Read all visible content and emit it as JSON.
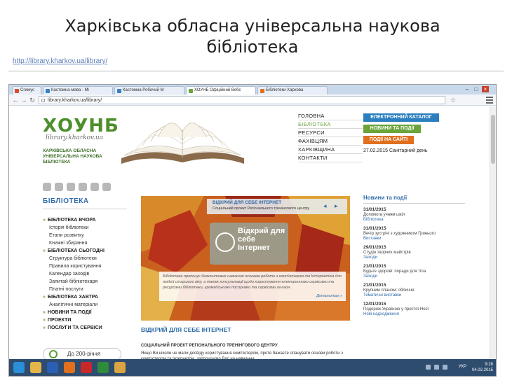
{
  "slide": {
    "title_line1": "Харківська обласна універсальна наукова",
    "title_line2": "бібліотека",
    "link": "http://library.kharkov.ua/library/"
  },
  "browser": {
    "tabs": [
      {
        "label": "Сгимус"
      },
      {
        "label": "Кастомна мова - Мі"
      },
      {
        "label": "Кастомна Робочий М"
      },
      {
        "label": "ХОУНБ Офіційний Вебс"
      },
      {
        "label": "Бібліотеки Харкова"
      }
    ],
    "url": "library.kharkov.ua/library/",
    "colors": {
      "tabbar": "#c9d9ec",
      "close": "#c8412f"
    }
  },
  "site": {
    "logo": {
      "mark": "ХОУНБ",
      "script": "library.kharkov.ua",
      "subtitle": "ХАРКІВСЬКА ОБЛАСНА УНІВЕРСАЛЬНА НАУКОВА БІБЛІОТЕКА"
    },
    "nav": [
      {
        "label": "ГОЛОВНА"
      },
      {
        "label": "БІБЛІОТЕКА"
      },
      {
        "label": "РЕСУРСИ"
      },
      {
        "label": "ФАХІВЦЯМ"
      },
      {
        "label": "ХАРКІВЩИНА"
      },
      {
        "label": "КОНТАКТИ"
      }
    ],
    "quick_buttons": [
      {
        "label": "ЕЛЕКТРОННИЙ КАТАЛОГ",
        "color": "#2b7ec0"
      },
      {
        "label": "НОВИНИ ТА ПОДІЇ",
        "color": "#6aa43b"
      },
      {
        "label": "ПОДІЇ НА САЙТІ",
        "color": "#e0701e"
      }
    ],
    "date_note": "27.02.2015 Санітарний день",
    "sidebar": {
      "title": "БІБЛІОТЕКА",
      "items": [
        {
          "label": "БІБЛІОТЕКА ВЧОРА",
          "kind": "head"
        },
        {
          "label": "Історія бібліотеки",
          "kind": "sub"
        },
        {
          "label": "Етапи розвитку",
          "kind": "sub"
        },
        {
          "label": "Книжні збирання",
          "kind": "sub"
        },
        {
          "label": "БІБЛІОТЕКА СЬОГОДНІ",
          "kind": "head"
        },
        {
          "label": "Структура бібліотеки",
          "kind": "sub"
        },
        {
          "label": "Правила користування",
          "kind": "sub"
        },
        {
          "label": "Календар заходів",
          "kind": "sub"
        },
        {
          "label": "Запитай бібліотекаря",
          "kind": "sub"
        },
        {
          "label": "Платні послуги",
          "kind": "sub"
        },
        {
          "label": "БІБЛІОТЕКА ЗАВТРА",
          "kind": "head"
        },
        {
          "label": "Аналітичні матеріали",
          "kind": "sub"
        },
        {
          "label": "НОВИНИ ТА ПОДІЇ",
          "kind": "head"
        },
        {
          "label": "ПРОЕКТИ",
          "kind": "head"
        },
        {
          "label": "ПОСЛУГИ ТА СЕРВІСИ",
          "kind": "head"
        }
      ],
      "bottom_badge": "До 200-річчя"
    },
    "banner": {
      "strip_title": "ВІДКРИЙ ДЛЯ СЕБЕ ІНТЕРНЕТ",
      "strip_sub": "Соціальний проект Регіонального тренінгового центру",
      "center_text": "Відкрий для себе Інтернет",
      "body": "Бібліотека пропонує безкоштовне навчання основам роботи з комп'ютером та Інтернетом для людей старшого віку, а також консультації щодо користування електронними сервісами та ресурсами бібліотеки, громадськими послугами та сервісами онлайн.",
      "more": "Детальніше »"
    },
    "feature": {
      "title": "ВІДКРИЙ ДЛЯ СЕБЕ ІНТЕРНЕТ",
      "subtitle": "СОЦІАЛЬНИЙ ПРОЕКТ РЕГІОНАЛЬНОГО ТРЕНІНГОВОГО ЦЕНТРУ",
      "body": "Якщо Ви ніколи не мали досвіду користування комп'ютером, проте бажаєте опанувати основи роботи з комп'ютером та Інтернетом, запрошуємо Вас на навчання."
    },
    "news": {
      "title": "Новини та події",
      "items": [
        {
          "date": "31/01/2015",
          "text": "Допомога учням шкіл",
          "tag": "Бібліотека"
        },
        {
          "date": "31/01/2015",
          "text": "Вечір зустрічі з художником Гринього",
          "tag": "Виставки"
        },
        {
          "date": "29/01/2015",
          "text": "Студія творчих майстрів",
          "tag": "Заходи"
        },
        {
          "date": "21/01/2015",
          "text": "Будьте здорові: поради для тіла",
          "tag": "Заходи"
        },
        {
          "date": "21/01/2015",
          "text": "Крупним планом: обличчя",
          "tag": "Тематичні виставки"
        },
        {
          "date": "12/01/2015",
          "text": "Подорож Україною у простої Ноєї",
          "tag": "Нові надходження"
        }
      ]
    }
  },
  "taskbar": {
    "lang": "УКР",
    "time": "9:28",
    "date": "04.02.2015",
    "apps": [
      {
        "name": "windows-start-icon",
        "color": "#2a8fd8"
      },
      {
        "name": "file-explorer-icon",
        "color": "#e3b54a"
      },
      {
        "name": "word-icon",
        "color": "#2b5fb4"
      },
      {
        "name": "firefox-icon",
        "color": "#e0701e"
      },
      {
        "name": "opera-icon",
        "color": "#c8282a"
      },
      {
        "name": "excel-icon",
        "color": "#2e8b3c"
      },
      {
        "name": "folder-icon",
        "color": "#d9a441"
      }
    ]
  }
}
